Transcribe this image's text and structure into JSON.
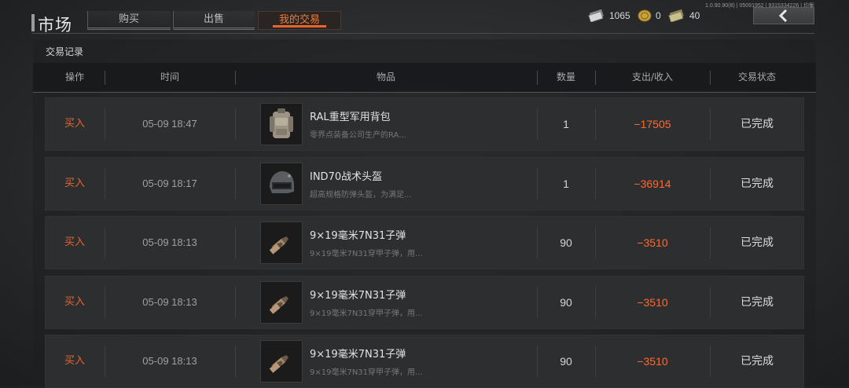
{
  "version": "1.0.90.90(8) | 05091952 | 9315334226 | 均衡",
  "title": "市场",
  "tabs": [
    {
      "label": "购买",
      "active": false
    },
    {
      "label": "出售",
      "active": false
    },
    {
      "label": "我的交易",
      "active": true
    }
  ],
  "currencies": [
    {
      "icon": "cash-icon",
      "value": "1065"
    },
    {
      "icon": "coin-icon",
      "value": "0"
    },
    {
      "icon": "bond-icon",
      "value": "40"
    }
  ],
  "colors": {
    "accent": "#e8652c",
    "amount": "#ff6a2c"
  },
  "section_title": "交易记录",
  "columns": [
    "操作",
    "时间",
    "物品",
    "数量",
    "支出/收入",
    "交易状态"
  ],
  "rows": [
    {
      "action": "买入",
      "time": "05-09 18:47",
      "item_icon": "backpack-icon",
      "item_name": "RAL重型军用背包",
      "item_desc": "零界点装备公司生产的RA...",
      "qty": "1",
      "amount": "−17505",
      "status": "已完成"
    },
    {
      "action": "买入",
      "time": "05-09 18:17",
      "item_icon": "helmet-icon",
      "item_name": "IND70战术头盔",
      "item_desc": "超高规格防弹头盔，为满足...",
      "qty": "1",
      "amount": "−36914",
      "status": "已完成"
    },
    {
      "action": "买入",
      "time": "05-09 18:13",
      "item_icon": "ammo-icon",
      "item_name": "9×19毫米7N31子弹",
      "item_desc": "9×19毫米7N31穿甲子弹，用...",
      "qty": "90",
      "amount": "−3510",
      "status": "已完成"
    },
    {
      "action": "买入",
      "time": "05-09 18:13",
      "item_icon": "ammo-icon",
      "item_name": "9×19毫米7N31子弹",
      "item_desc": "9×19毫米7N31穿甲子弹，用...",
      "qty": "90",
      "amount": "−3510",
      "status": "已完成"
    },
    {
      "action": "买入",
      "time": "05-09 18:13",
      "item_icon": "ammo-icon",
      "item_name": "9×19毫米7N31子弹",
      "item_desc": "9×19毫米7N31穿甲子弹，用...",
      "qty": "90",
      "amount": "−3510",
      "status": "已完成"
    }
  ]
}
